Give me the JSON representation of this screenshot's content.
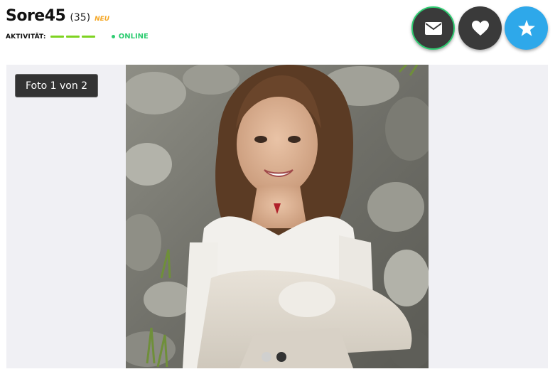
{
  "profile": {
    "username": "Sore45",
    "age": "(35)",
    "new_badge": "NEU",
    "activity_label": "AKTIVITÄT:",
    "activity_level": "3 of 3",
    "online_label": "ONLINE"
  },
  "actions": {
    "message_icon": "envelope-icon",
    "like_icon": "heart-icon",
    "favorite_icon": "star-icon"
  },
  "gallery": {
    "counter": "Foto 1 von 2",
    "current": 1,
    "total": 2
  },
  "colors": {
    "online": "#2ecc71",
    "activity": "#7ed321",
    "new_badge": "#f5a623",
    "favorite_button": "#2ea8ea",
    "dark_button": "#3a3a3a"
  }
}
